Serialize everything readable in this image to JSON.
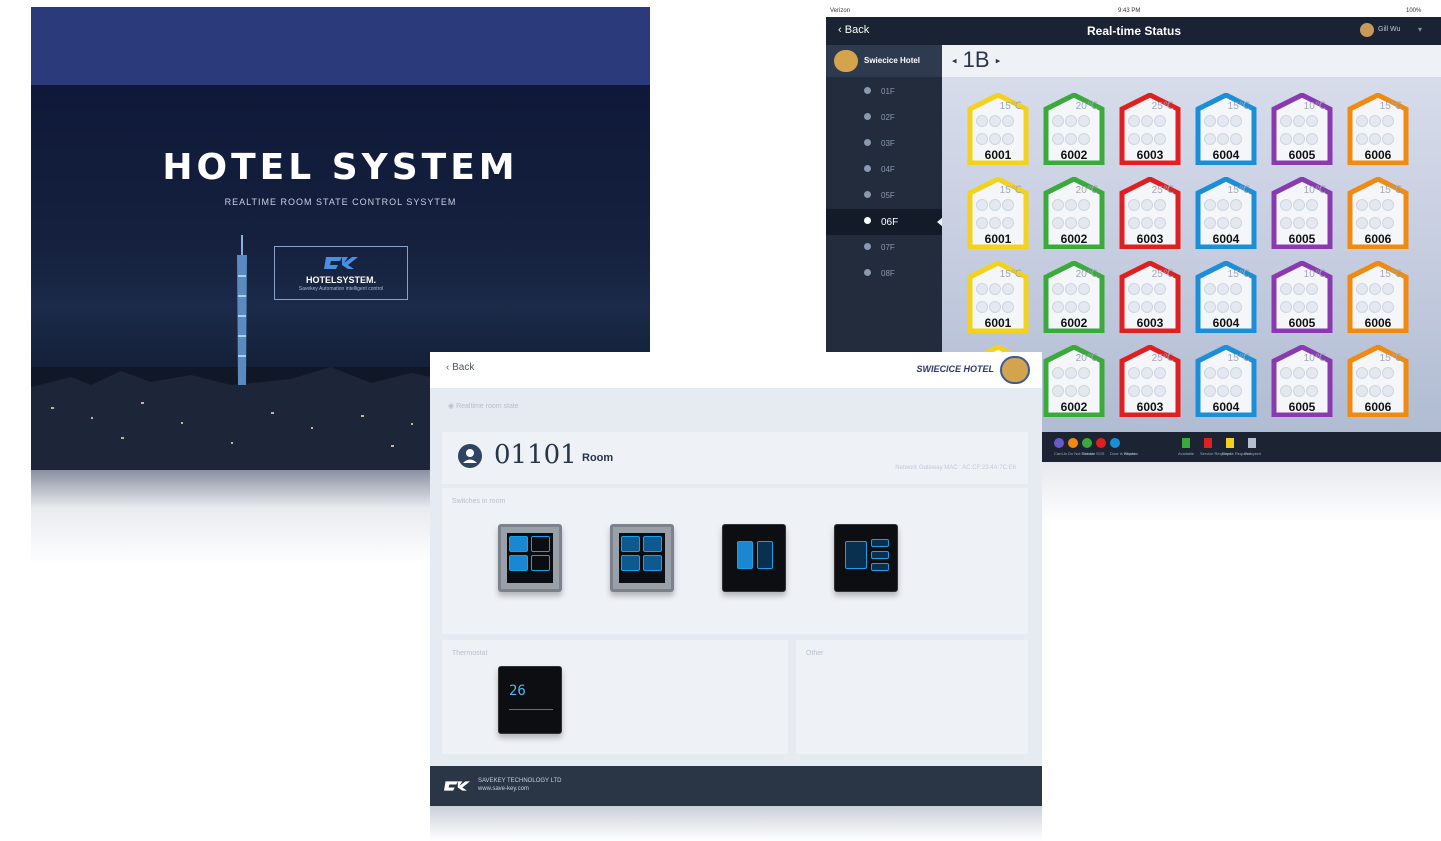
{
  "splash": {
    "title": "HOTEL SYSTEM",
    "subtitle": "REALTIME ROOM STATE CONTROL SYSYTEM",
    "logo_name": "HOTELSYSTEM.",
    "logo_tagline": "Savekey Automation intelligent control"
  },
  "status_panel": {
    "carrier": "Verizon",
    "time": "9:43 PM",
    "battery": "100%",
    "back_label": "Back",
    "title": "Real-time Status",
    "user_name": "Gill Wu",
    "hotel_name": "Swiecice Hotel",
    "building": "1B",
    "floors": [
      {
        "label": "01F",
        "active": false
      },
      {
        "label": "02F",
        "active": false
      },
      {
        "label": "03F",
        "active": false
      },
      {
        "label": "04F",
        "active": false
      },
      {
        "label": "05F",
        "active": false
      },
      {
        "label": "06F",
        "active": true
      },
      {
        "label": "07F",
        "active": false
      },
      {
        "label": "08F",
        "active": false
      }
    ],
    "room_columns": [
      {
        "number": "6001",
        "temp": "15℃",
        "color": "#f2d21a"
      },
      {
        "number": "6002",
        "temp": "20℃",
        "color": "#3aaa3a"
      },
      {
        "number": "6003",
        "temp": "25℃",
        "color": "#e02020"
      },
      {
        "number": "6004",
        "temp": "15℃",
        "color": "#1a8fd8"
      },
      {
        "number": "6005",
        "temp": "10℃",
        "color": "#8a3ab0"
      },
      {
        "number": "6006",
        "temp": "15℃",
        "color": "#f08a10"
      }
    ],
    "legend": [
      {
        "label": "Card-In",
        "color": "#6a5ac8"
      },
      {
        "label": "Do Not Disturb",
        "color": "#f08a10"
      },
      {
        "label": "Service",
        "color": "#3aaa3a"
      },
      {
        "label": "SOS",
        "color": "#e02020"
      },
      {
        "label": "Door is Window",
        "color": "#1a8fd8"
      },
      {
        "label": "Repair",
        "color": "#1c2433"
      }
    ],
    "legend_status": [
      {
        "label": "Available",
        "color": "#3aaa3a"
      },
      {
        "label": "Service Required",
        "color": "#e02020"
      },
      {
        "label": "Repair Required",
        "color": "#f2d21a"
      },
      {
        "label": "Occupied",
        "color": "#b8c0d0"
      }
    ]
  },
  "detail_panel": {
    "back_label": "Back",
    "hotel_name": "SWIECICE HOTEL",
    "breadcrumb": "Realtime room state",
    "room_number": "01101",
    "room_label": "Room",
    "gateway": "Network Gateway MAC : AC:CF:23:4A:7C:E6",
    "switches_title": "Switches in room",
    "thermostat_title": "Thermostat",
    "other_title": "Other",
    "thermostat_display": "26",
    "footer_company": "SAVEKEY TECHNOLOGY LTD",
    "footer_url": "www.save-key.com"
  }
}
